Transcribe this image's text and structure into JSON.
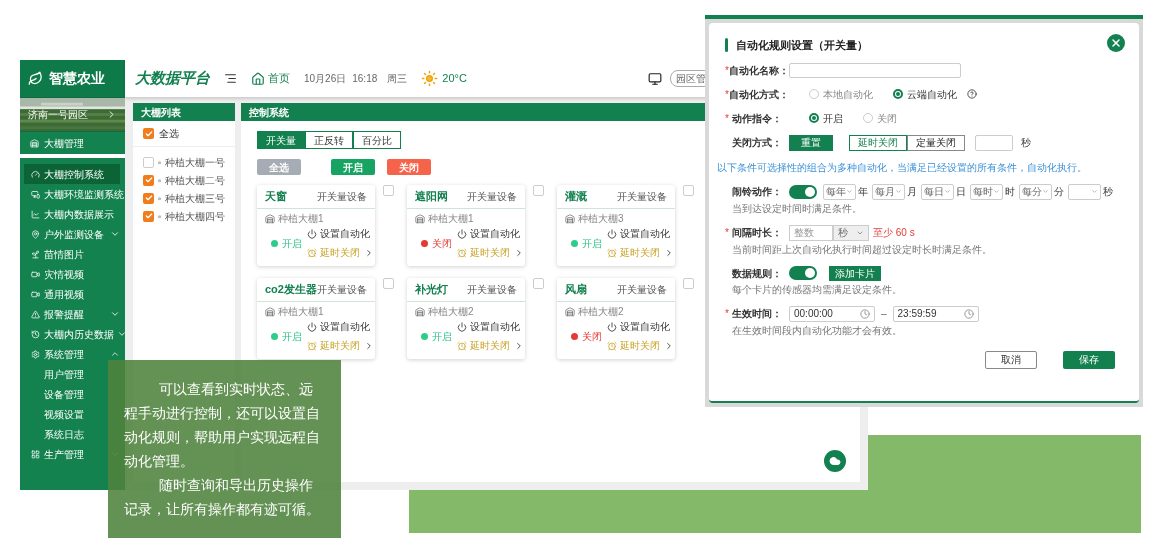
{
  "sidebar": {
    "logo": "智慧农业",
    "park": "济南一号园区",
    "management": "大棚管理",
    "items": [
      {
        "label": "大棚控制系统",
        "selected": true
      },
      {
        "label": "大棚环境监测系统",
        "selected": false
      },
      {
        "label": "大棚内数据展示",
        "selected": false
      },
      {
        "label": "户外监测设备",
        "selected": false,
        "expanded": false
      },
      {
        "label": "苗情图片",
        "selected": false
      },
      {
        "label": "灾情视频",
        "selected": false
      },
      {
        "label": "通用视频",
        "selected": false
      },
      {
        "label": "报警提醒",
        "selected": false,
        "expanded": false
      },
      {
        "label": "大棚内历史数据",
        "selected": false,
        "expanded": false
      },
      {
        "label": "系统管理",
        "selected": false,
        "expanded": true,
        "children": [
          {
            "label": "用户管理"
          },
          {
            "label": "设备管理"
          },
          {
            "label": "视频设置"
          },
          {
            "label": "系统日志"
          }
        ]
      },
      {
        "label": "生产管理",
        "selected": false,
        "expanded": false
      }
    ]
  },
  "header": {
    "title": "大数据平台",
    "home": "首页",
    "date": "10月26日",
    "time": "16:18",
    "weekday": "周三",
    "temperature": "20°C",
    "park_button": "园区管"
  },
  "greenhouse_list": {
    "title": "大棚列表",
    "select_all": {
      "label": "全选",
      "checked": true
    },
    "items": [
      {
        "label": "种植大棚一号",
        "checked": false
      },
      {
        "label": "种植大棚二号",
        "checked": true
      },
      {
        "label": "种植大棚三号",
        "checked": true
      },
      {
        "label": "种植大棚四号",
        "checked": true
      }
    ]
  },
  "control": {
    "title": "控制系统",
    "tabs": [
      {
        "label": "开关量",
        "selected": true
      },
      {
        "label": "正反转",
        "selected": false
      },
      {
        "label": "百分比",
        "selected": false
      }
    ],
    "buttons": [
      {
        "label": "全选",
        "kind": "neutral"
      },
      {
        "label": "开启",
        "kind": "on"
      },
      {
        "label": "关闭",
        "kind": "off"
      }
    ],
    "devices": [
      {
        "name": "天窗",
        "type": "开关量设备",
        "location": "种植大棚1",
        "status": "开启",
        "on": true,
        "auto": "设置自动化",
        "delay": "延时关闭",
        "checked": false
      },
      {
        "name": "遮阳网",
        "type": "开关量设备",
        "location": "种植大棚1",
        "status": "关闭",
        "on": false,
        "auto": "设置自动化",
        "delay": "延时关闭",
        "checked": false
      },
      {
        "name": "灌溉",
        "type": "开关量设备",
        "location": "种植大棚3",
        "status": "开启",
        "on": true,
        "auto": "设置自动化",
        "delay": "延时关闭",
        "checked": false
      },
      {
        "name": "co2发生器",
        "type": "开关量设备",
        "location": "种植大棚1",
        "status": "开启",
        "on": true,
        "auto": "设置自动化",
        "delay": "延时关闭",
        "checked": false
      },
      {
        "name": "补光灯",
        "type": "开关量设备",
        "location": "种植大棚2",
        "status": "开启",
        "on": true,
        "auto": "设置自动化",
        "delay": "延时关闭",
        "checked": false
      },
      {
        "name": "风扇",
        "type": "开关量设备",
        "location": "种植大棚2",
        "status": "关闭",
        "on": false,
        "auto": "设置自动化",
        "delay": "延时关闭",
        "checked": false
      }
    ]
  },
  "dialog": {
    "title": "自动化规则设置（开关量）",
    "name_field": {
      "label": "自动化名称：",
      "required_mark": "*"
    },
    "mode": {
      "label": "自动化方式：",
      "required_mark": "*",
      "options": [
        {
          "label": "本地自动化",
          "selected": false
        },
        {
          "label": "云端自动化",
          "selected": true
        }
      ]
    },
    "command": {
      "label": "动作指令：",
      "required_mark": "*",
      "options": [
        {
          "label": "开启",
          "selected": true
        },
        {
          "label": "关闭",
          "selected": false
        }
      ]
    },
    "close_mode": {
      "label": "关闭方式：",
      "reset": "重置",
      "options": [
        {
          "label": "延时关闭",
          "selected": true
        },
        {
          "label": "定量关闭",
          "selected": false
        }
      ],
      "unit": "秒"
    },
    "note": "以下条件可选择性的组合为多种自动化，当满足已经设置的所有条件，自动化执行。",
    "alarm": {
      "label": "闹铃动作：",
      "on": true,
      "selects": [
        {
          "value": "每年",
          "unit": "年"
        },
        {
          "value": "每月",
          "unit": "月"
        },
        {
          "value": "每日",
          "unit": "日"
        },
        {
          "value": "每时",
          "unit": "时"
        },
        {
          "value": "每分",
          "unit": "分"
        },
        {
          "unit": "秒"
        }
      ],
      "hint": "当到达设定时间时满足条件。"
    },
    "interval": {
      "label": "间隔时长：",
      "required_mark": "*",
      "placeholder": "整数",
      "unit": "秒",
      "warning": "至少 60 s",
      "hint": "当前时间距上次自动化执行时间超过设定时长时满足条件。"
    },
    "data_rule": {
      "label": "数据规则：",
      "on": true,
      "button": "添加卡片",
      "hint": "每个卡片的传感器均需满足设定条件。"
    },
    "active_time": {
      "label": "生效时间：",
      "required_mark": "*",
      "start": "00:00:00",
      "separator": "–",
      "end": "23:59:59",
      "hint": "在生效时间段内自动化功能才会有效。"
    },
    "cancel": "取消",
    "save": "保存"
  },
  "caption": {
    "paragraphs": [
      "可以查看到实时状态、远程手动进行控制，还可以设置自动化规则，帮助用户实现远程自动化管理。",
      "随时查询和导出历史操作记录，让所有操作都有迹可循。"
    ]
  }
}
